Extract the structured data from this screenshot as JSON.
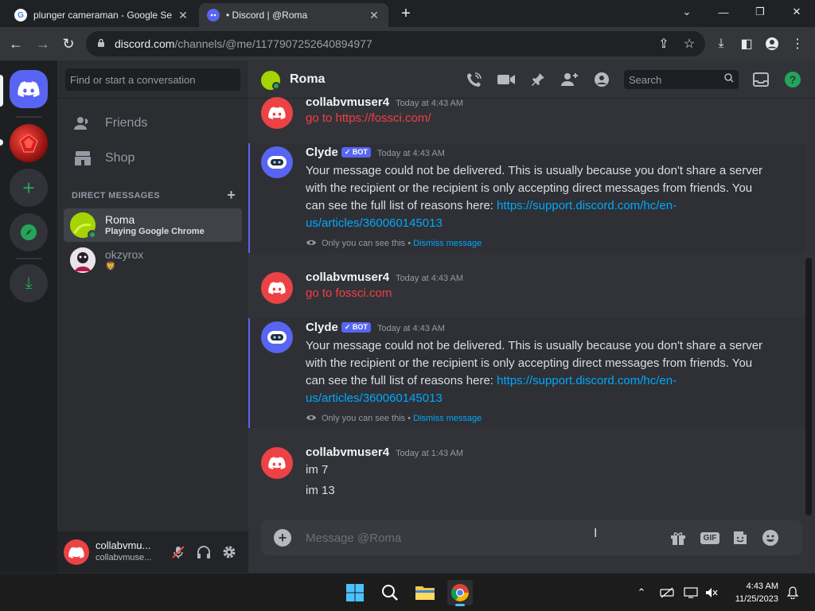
{
  "browser": {
    "tabs": [
      {
        "title": "plunger cameraman - Google Se",
        "favicon": "google-g-icon",
        "active": false
      },
      {
        "title": "• Discord | @Roma",
        "favicon": "discord-icon",
        "active": true
      }
    ],
    "url_host": "discord.com",
    "url_path": "/channels/@me/1177907252640894977"
  },
  "sidebar": {
    "search_placeholder": "Find or start a conversation",
    "nav": [
      {
        "label": "Friends",
        "icon": "friends-icon"
      },
      {
        "label": "Shop",
        "icon": "shop-icon"
      }
    ],
    "dm_header": "DIRECT MESSAGES",
    "dms": [
      {
        "name": "Roma",
        "status": "Playing Google Chrome",
        "selected": true
      },
      {
        "name": "okzyrox",
        "status": "🦁",
        "selected": false
      }
    ]
  },
  "user_panel": {
    "name": "collabvmu...",
    "sub": "collabvmuse..."
  },
  "chat": {
    "recipient": "Roma",
    "search_placeholder": "Search",
    "messages": [
      {
        "author": "collabvmuser4",
        "time": "Today at 4:43 AM",
        "lines": [
          "go to https://fossci.com/"
        ]
      },
      {
        "author": "Clyde",
        "bot_tag": "✓ BOT",
        "time": "Today at 4:43 AM",
        "text": "Your message could not be delivered. This is usually because you don't share a server with the recipient or the recipient is only accepting direct messages from friends. You can see the full list of reasons here: ",
        "link": "https://support.discord.com/hc/en-us/articles/360060145013",
        "ephemeral": "Only you can see this •",
        "dismiss": "Dismiss message"
      },
      {
        "author": "collabvmuser4",
        "time": "Today at 4:43 AM",
        "lines": [
          "go to fossci.com"
        ]
      },
      {
        "author": "Clyde",
        "bot_tag": "✓ BOT",
        "time": "Today at 4:43 AM",
        "text": "Your message could not be delivered. This is usually because you don't share a server with the recipient or the recipient is only accepting direct messages from friends. You can see the full list of reasons here: ",
        "link": "https://support.discord.com/hc/en-us/articles/360060145013",
        "ephemeral": "Only you can see this •",
        "dismiss": "Dismiss message"
      },
      {
        "author": "collabvmuser4",
        "time": "Today at 1:43 AM",
        "lines": [
          "im 7",
          "im 13"
        ]
      }
    ],
    "composer_placeholder": "Message @Roma",
    "gif_label": "GIF"
  },
  "taskbar": {
    "time": "4:43 AM",
    "date": "11/25/2023"
  },
  "colors": {
    "blurple": "#5865f2",
    "green": "#23a559",
    "red": "#ed4245",
    "link": "#00a8fc"
  }
}
